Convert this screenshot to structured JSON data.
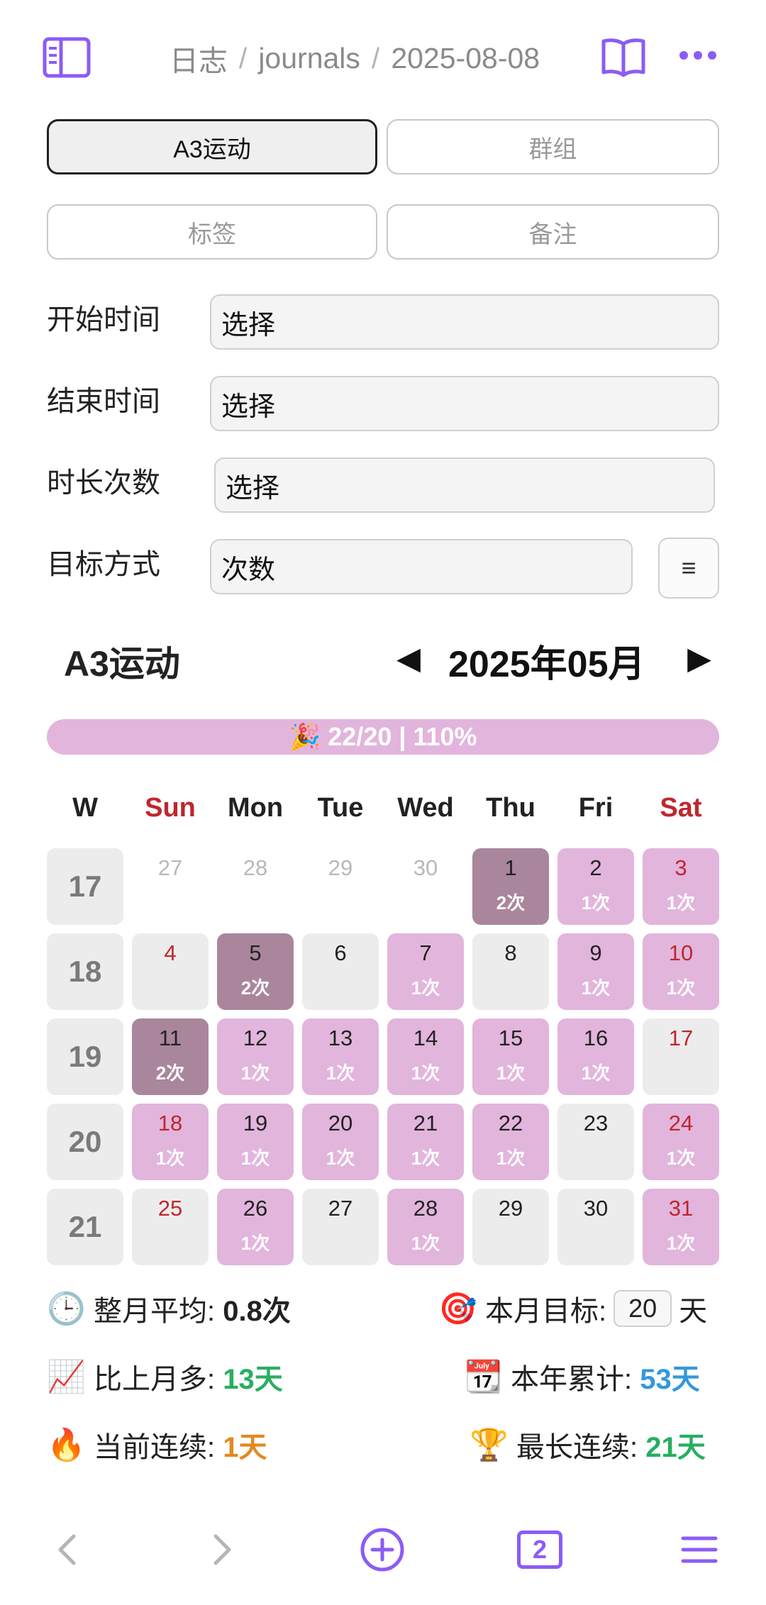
{
  "breadcrumb": {
    "part1": "日志",
    "sep": "/",
    "part2": "journals",
    "part3": "2025-08-08"
  },
  "tabs": {
    "a3": "A3运动",
    "group": "群组",
    "tags": "标签",
    "notes": "备注"
  },
  "form": {
    "start_label": "开始时间",
    "start_value": "选择",
    "end_label": "结束时间",
    "end_value": "选择",
    "duration_label": "时长次数",
    "duration_value": "选择",
    "goal_label": "目标方式",
    "goal_value": "次数",
    "menu_icon": "≡"
  },
  "calendar": {
    "title": "A3运动",
    "prev": "◀",
    "next": "▶",
    "month": "2025年05月",
    "progress": "🎉 22/20 | 110%",
    "dow": [
      "W",
      "Sun",
      "Mon",
      "Tue",
      "Wed",
      "Thu",
      "Fri",
      "Sat"
    ],
    "weeks": [
      {
        "wk": "17",
        "days": [
          {
            "d": "27",
            "c": "",
            "lvl": 0,
            "out": true
          },
          {
            "d": "28",
            "c": "",
            "lvl": 0,
            "out": true
          },
          {
            "d": "29",
            "c": "",
            "lvl": 0,
            "out": true
          },
          {
            "d": "30",
            "c": "",
            "lvl": 0,
            "out": true
          },
          {
            "d": "1",
            "c": "2次",
            "lvl": 2
          },
          {
            "d": "2",
            "c": "1次",
            "lvl": 1
          },
          {
            "d": "3",
            "c": "1次",
            "lvl": 1
          }
        ]
      },
      {
        "wk": "18",
        "days": [
          {
            "d": "4",
            "c": "",
            "lvl": 0
          },
          {
            "d": "5",
            "c": "2次",
            "lvl": 2
          },
          {
            "d": "6",
            "c": "",
            "lvl": 0
          },
          {
            "d": "7",
            "c": "1次",
            "lvl": 1
          },
          {
            "d": "8",
            "c": "",
            "lvl": 0
          },
          {
            "d": "9",
            "c": "1次",
            "lvl": 1
          },
          {
            "d": "10",
            "c": "1次",
            "lvl": 1
          }
        ]
      },
      {
        "wk": "19",
        "days": [
          {
            "d": "11",
            "c": "2次",
            "lvl": 2
          },
          {
            "d": "12",
            "c": "1次",
            "lvl": 1
          },
          {
            "d": "13",
            "c": "1次",
            "lvl": 1
          },
          {
            "d": "14",
            "c": "1次",
            "lvl": 1
          },
          {
            "d": "15",
            "c": "1次",
            "lvl": 1
          },
          {
            "d": "16",
            "c": "1次",
            "lvl": 1
          },
          {
            "d": "17",
            "c": "",
            "lvl": 0
          }
        ]
      },
      {
        "wk": "20",
        "days": [
          {
            "d": "18",
            "c": "1次",
            "lvl": 1
          },
          {
            "d": "19",
            "c": "1次",
            "lvl": 1
          },
          {
            "d": "20",
            "c": "1次",
            "lvl": 1
          },
          {
            "d": "21",
            "c": "1次",
            "lvl": 1
          },
          {
            "d": "22",
            "c": "1次",
            "lvl": 1
          },
          {
            "d": "23",
            "c": "",
            "lvl": 0
          },
          {
            "d": "24",
            "c": "1次",
            "lvl": 1
          }
        ]
      },
      {
        "wk": "21",
        "days": [
          {
            "d": "25",
            "c": "",
            "lvl": 0
          },
          {
            "d": "26",
            "c": "1次",
            "lvl": 1
          },
          {
            "d": "27",
            "c": "",
            "lvl": 0
          },
          {
            "d": "28",
            "c": "1次",
            "lvl": 1
          },
          {
            "d": "29",
            "c": "",
            "lvl": 0
          },
          {
            "d": "30",
            "c": "",
            "lvl": 0
          },
          {
            "d": "31",
            "c": "1次",
            "lvl": 1
          }
        ]
      }
    ]
  },
  "stats": {
    "avg_emoji": "🕒",
    "avg_label": "整月平均:",
    "avg_value": "0.8次",
    "goal_emoji": "🎯",
    "goal_label": "本月目标:",
    "goal_value": "20",
    "goal_unit": "天",
    "more_emoji": "📈",
    "more_label": "比上月多:",
    "more_value": "13天",
    "year_emoji": "📆",
    "year_label": "本年累计:",
    "year_value": "53天",
    "cur_emoji": "🔥",
    "cur_label": "当前连续:",
    "cur_value": "1天",
    "best_emoji": "🏆",
    "best_label": "最长连续:",
    "best_value": "21天"
  },
  "bottombar": {
    "tab_count": "2"
  },
  "colors": {
    "accent": "#8b5cf6",
    "done": "#e2b5dc",
    "double": "#a9869c",
    "weekend": "#c0262d"
  }
}
